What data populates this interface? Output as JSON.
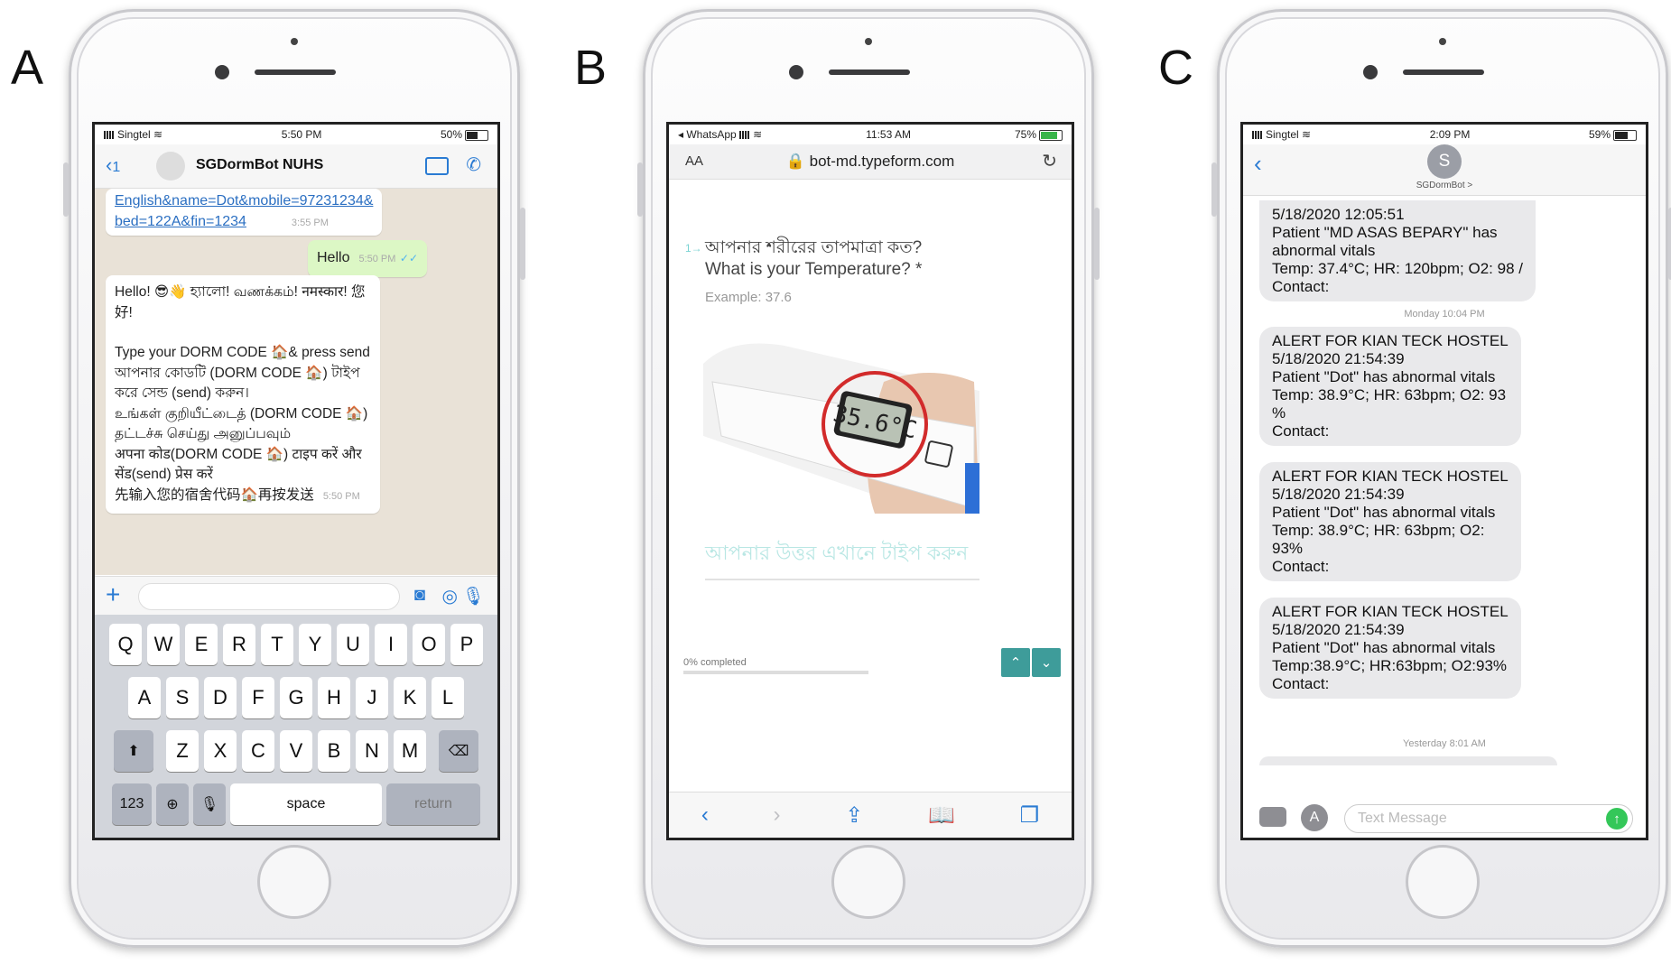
{
  "panels": {
    "a": "A",
    "b": "B",
    "c": "C"
  },
  "phone_a": {
    "status": {
      "carrier": "Singtel",
      "time": "5:50 PM",
      "battery": "50%",
      "battery_level": 0.5
    },
    "header": {
      "back": "1",
      "title": "SGDormBot NUHS"
    },
    "messages": {
      "link_line1": "English&name=Dot&mobile=97231234&",
      "link_line2": "bed=122A&fin=1234",
      "link_time": "3:55 PM",
      "hello": "Hello",
      "hello_time": "5:50 PM",
      "welcome_lines": [
        "Hello! 😎👋 হ্যালো! வணக்கம்! नमस्कार! 您",
        "好!",
        "",
        "Type your DORM CODE 🏠& press send",
        "আপনার কোডটি (DORM CODE 🏠) টাইপ",
        "করে সেন্ড (send) করুন।",
        "உங்கள் குறியீட்டைத் (DORM CODE 🏠)",
        "தட்டச்சு செய்து அனுப்பவும்",
        "अपना कोड(DORM CODE 🏠) टाइप करें और",
        "सेंड(send) प्रेस करें",
        "先输入您的宿舍代码🏠再按发送"
      ],
      "welcome_time": "5:50 PM"
    },
    "keyboard": {
      "row1": [
        "Q",
        "W",
        "E",
        "R",
        "T",
        "Y",
        "U",
        "I",
        "O",
        "P"
      ],
      "row2": [
        "A",
        "S",
        "D",
        "F",
        "G",
        "H",
        "J",
        "K",
        "L"
      ],
      "row3": [
        "Z",
        "X",
        "C",
        "V",
        "B",
        "N",
        "M"
      ],
      "num": "123",
      "space": "space",
      "return": "return"
    }
  },
  "phone_b": {
    "status": {
      "back_app": "◂ WhatsApp",
      "time": "11:53 AM",
      "battery": "75%",
      "battery_level": 0.75
    },
    "address": {
      "aa": "AA",
      "url": "bot-md.typeform.com"
    },
    "question": {
      "number": "1→",
      "line1": "আপনার শরীরের তাপমাত্রা কত?",
      "line2": "What is your Temperature? *",
      "example": "Example: 37.6",
      "thermometer_reading": "35.6°C",
      "answer_placeholder": "আপনার উত্তর এখানে টাইপ করুন"
    },
    "progress": {
      "label": "0% completed",
      "value": 0
    }
  },
  "phone_c": {
    "status": {
      "carrier": "Singtel",
      "time": "2:09 PM",
      "battery": "59%",
      "battery_level": 0.59
    },
    "contact": {
      "initial": "S",
      "name": "SGDormBot >"
    },
    "messages": [
      {
        "lines": [
          "5/18/2020 12:05:51",
          "Patient \"MD ASAS BEPARY\" has",
          "abnormal vitals",
          "Temp: 37.4°C; HR: 120bpm; O2: 98 /",
          "Contact:"
        ]
      },
      {
        "lines": [
          "ALERT FOR KIAN TECK HOSTEL",
          "5/18/2020 21:54:39",
          "Patient \"Dot\" has abnormal vitals",
          "Temp: 38.9°C; HR:  63bpm; O2: 93",
          "%",
          "Contact:"
        ]
      },
      {
        "lines": [
          "ALERT FOR KIAN TECK HOSTEL",
          "5/18/2020 21:54:39",
          "Patient \"Dot\" has abnormal vitals",
          "Temp: 38.9°C; HR:  63bpm; O2:",
          "93%",
          "Contact:"
        ]
      },
      {
        "lines": [
          "ALERT FOR KIAN TECK HOSTEL",
          "5/18/2020 21:54:39",
          "Patient \"Dot\" has abnormal vitals",
          "Temp:38.9°C; HR:63bpm; O2:93%",
          "Contact:"
        ]
      }
    ],
    "timestamps": {
      "monday": "Monday 10:04 PM",
      "yesterday": "Yesterday 8:01 AM"
    },
    "input_placeholder": "Text Message"
  }
}
